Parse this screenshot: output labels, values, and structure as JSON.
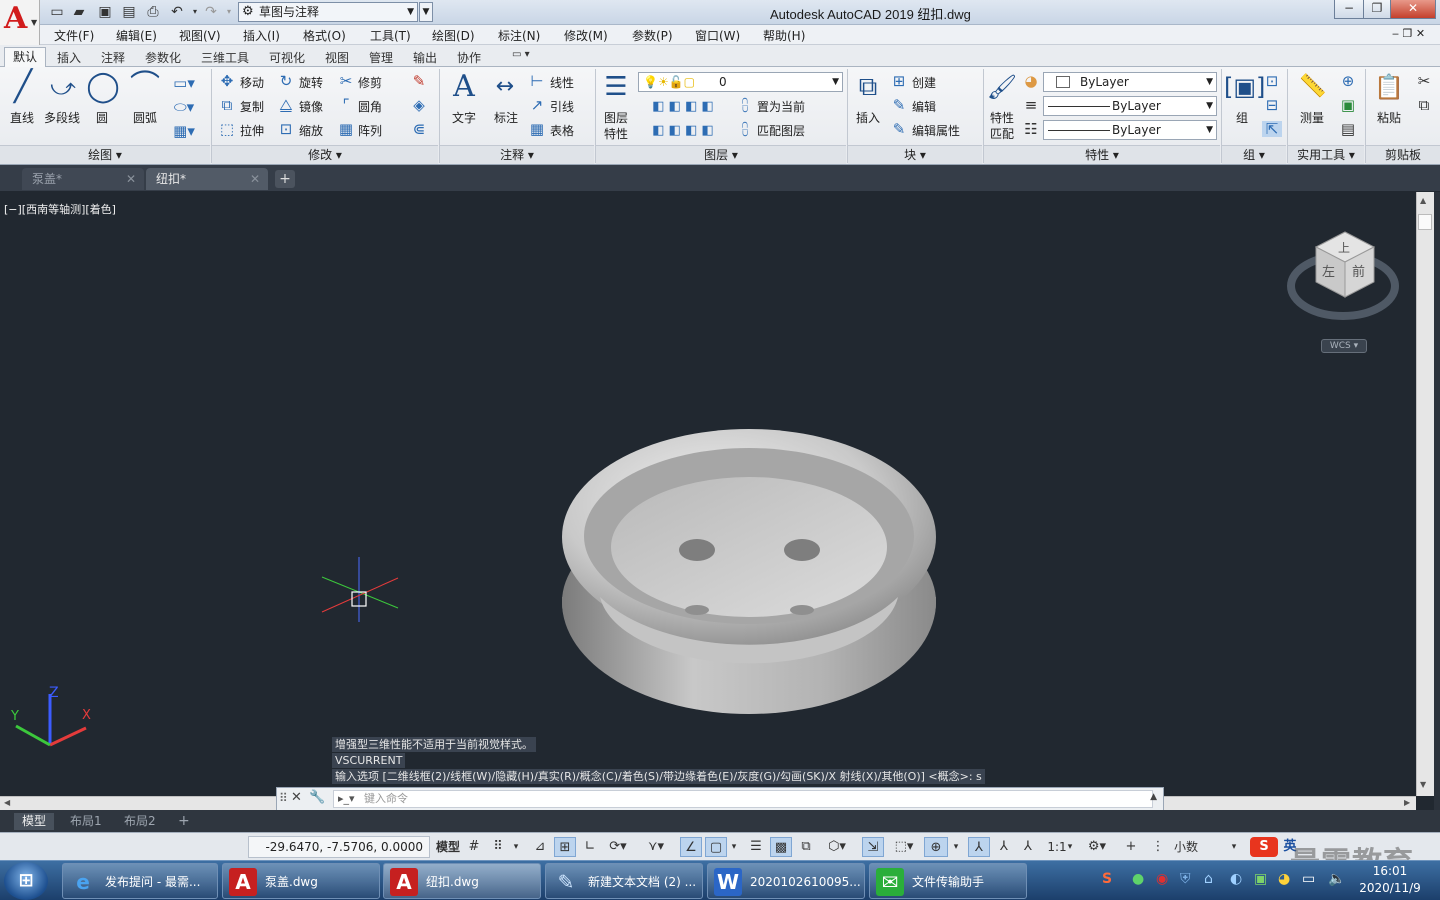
{
  "titlebar": {
    "workspace": "草图与注释",
    "title": "Autodesk AutoCAD 2019    纽扣.dwg",
    "min": "−",
    "max": "❐",
    "close": "✕"
  },
  "menu": [
    "文件(F)",
    "编辑(E)",
    "视图(V)",
    "插入(I)",
    "格式(O)",
    "工具(T)",
    "绘图(D)",
    "标注(N)",
    "修改(M)",
    "参数(P)",
    "窗口(W)",
    "帮助(H)"
  ],
  "ribbon_tabs": [
    "默认",
    "插入",
    "注释",
    "参数化",
    "三维工具",
    "可视化",
    "视图",
    "管理",
    "输出",
    "协作"
  ],
  "draw": {
    "line": "直线",
    "polyline": "多段线",
    "circle": "圆",
    "arc": "圆弧",
    "title": "绘图 ▾"
  },
  "modify": {
    "move": "移动",
    "rotate": "旋转",
    "trim": "修剪",
    "copy": "复制",
    "mirror": "镜像",
    "fillet": "圆角",
    "stretch": "拉伸",
    "scale": "缩放",
    "array": "阵列",
    "title": "修改 ▾"
  },
  "annotation": {
    "text": "文字",
    "dimension": "标注",
    "linear": "线性",
    "leader": "引线",
    "table": "表格",
    "title": "注释 ▾"
  },
  "layers": {
    "layer_props": "图层",
    "layer_props2": "特性",
    "current_layer": "0",
    "make_current": "置为当前",
    "match_layer": "匹配图层",
    "title": "图层 ▾"
  },
  "block": {
    "insert": "插入",
    "create": "创建",
    "edit": "编辑",
    "edit_attr": "编辑属性",
    "title": "块 ▾"
  },
  "properties": {
    "match1": "特性",
    "match2": "匹配",
    "color": "ByLayer",
    "linetype": "ByLayer",
    "lineweight": "ByLayer",
    "title": "特性 ▾"
  },
  "groups": {
    "group": "组",
    "title": "组 ▾"
  },
  "utilities": {
    "measure": "测量",
    "title": "实用工具 ▾"
  },
  "clipboard": {
    "paste": "粘贴",
    "title": "剪贴板"
  },
  "file_tabs": [
    {
      "label": "泵盖*"
    },
    {
      "label": "纽扣*"
    }
  ],
  "viewport": {
    "label": "[−][西南等轴测][着色]",
    "viewcube_top": "上",
    "viewcube_left": "左",
    "viewcube_front": "前",
    "wcs": "WCS"
  },
  "command": {
    "history": [
      "增强型三维性能不适用于当前视觉样式。",
      "VSCURRENT",
      "输入选项 [二维线框(2)/线框(W)/隐藏(H)/真实(R)/概念(C)/着色(S)/带边缘着色(E)/灰度(G)/勾画(SK)/X 射线(X)/其他(O)] <概念>: s"
    ],
    "placeholder": "键入命令"
  },
  "layout_tabs": [
    "模型",
    "布局1",
    "布局2"
  ],
  "status": {
    "coords": "-29.6470, -7.5706, 0.0000",
    "model": "模型",
    "scale": "1:1",
    "units": "小数"
  },
  "taskbar": [
    {
      "label": "发布提问 - 最需...",
      "icon": "e"
    },
    {
      "label": "泵盖.dwg",
      "icon": "A"
    },
    {
      "label": "纽扣.dwg",
      "icon": "A"
    },
    {
      "label": "新建文本文档 (2) ...",
      "icon": "✎"
    },
    {
      "label": "2020102610095...",
      "icon": "W"
    },
    {
      "label": "文件传输助手",
      "icon": "✉"
    }
  ],
  "clock": {
    "time": "16:01",
    "date": "2020/11/9"
  },
  "ime": "英",
  "watermark": "最需教育",
  "colors": {
    "viewport_bg": "#212830",
    "accent": "#2d6cb3",
    "autocad_red": "#d11b1b"
  }
}
